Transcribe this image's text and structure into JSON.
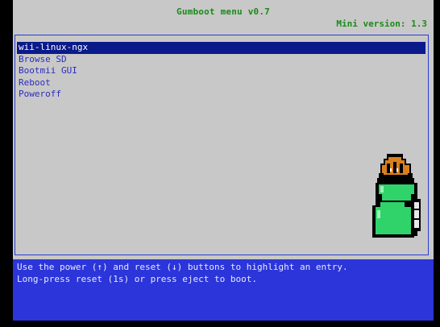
{
  "header": {
    "title": "Gumboot menu v0.7",
    "mini_version": "Mini version: 1.3"
  },
  "menu": {
    "items": [
      {
        "label": "wii-linux-ngx",
        "selected": true
      },
      {
        "label": "Browse SD",
        "selected": false
      },
      {
        "label": "Bootmii GUI",
        "selected": false
      },
      {
        "label": "Reboot",
        "selected": false
      },
      {
        "label": "Poweroff",
        "selected": false
      }
    ]
  },
  "footer": {
    "line1": "Use the power (↑) and reset (↓) buttons to highlight an entry.",
    "line2": "Long-press reset (1s) or press eject to boot."
  },
  "colors": {
    "screen_bg": "#c8c8c8",
    "title_green": "#1b8a1b",
    "menu_text": "#2b2cc0",
    "selected_bg": "#0a1a8a",
    "footer_bg": "#2b35d9",
    "mascot_green": "#2fd36a",
    "mascot_orange": "#d9801e"
  },
  "icons": {
    "mascot": "gumboot-mascot-icon"
  }
}
